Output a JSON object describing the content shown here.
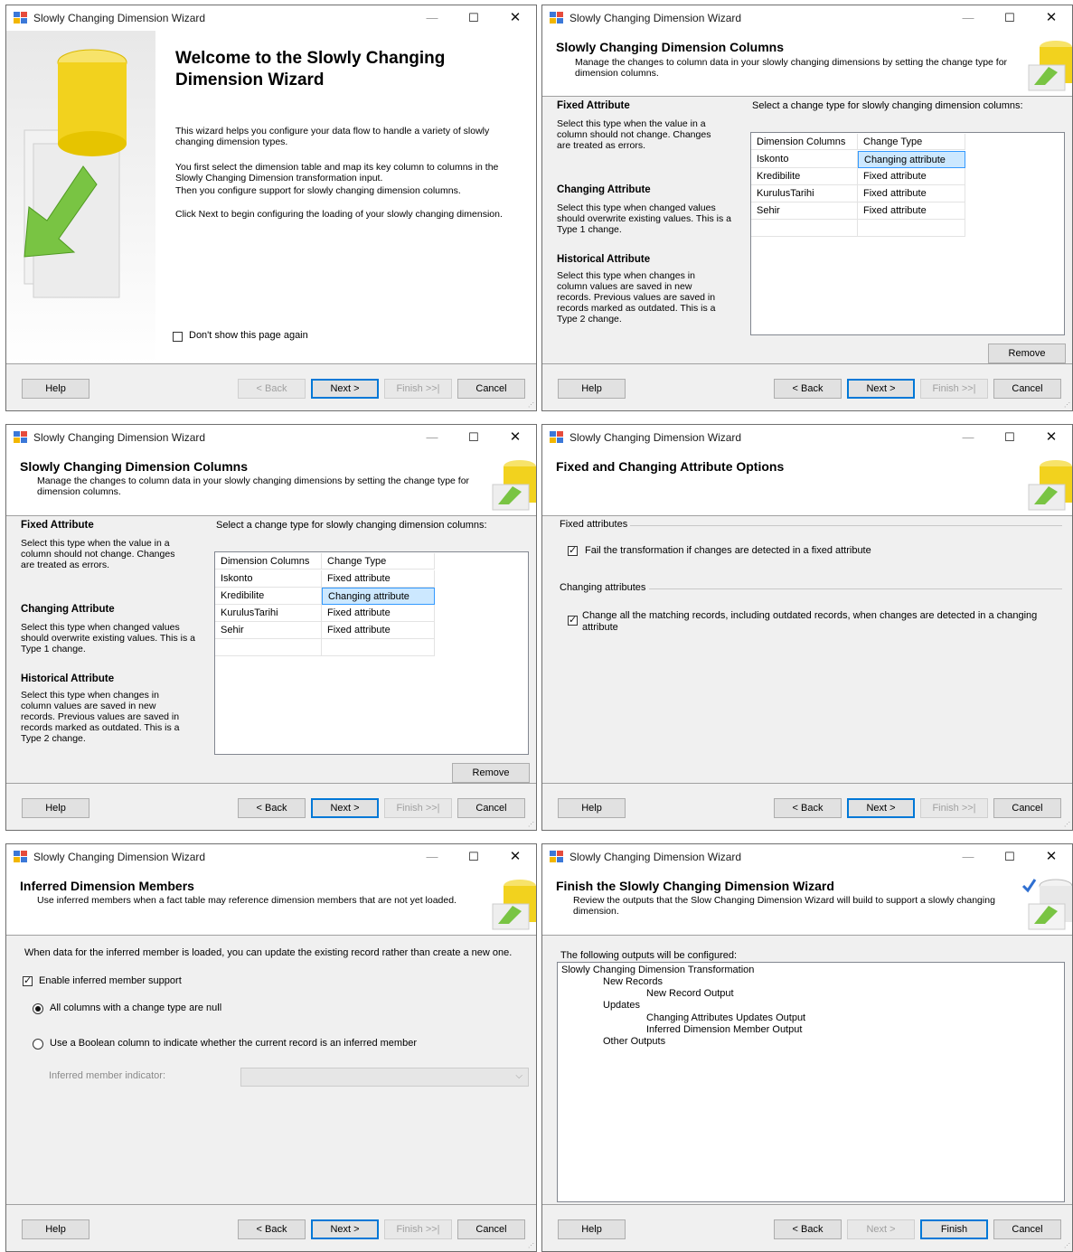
{
  "window": {
    "title": "Slowly Changing Dimension Wizard",
    "minimize": "—",
    "maximize": "☐",
    "close": "✕"
  },
  "buttons": {
    "help": "Help",
    "back": "< Back",
    "next": "Next >",
    "finish": "Finish >>|",
    "finish_final": "Finish",
    "cancel": "Cancel",
    "remove": "Remove"
  },
  "welcome": {
    "title": "Welcome to the Slowly Changing Dimension Wizard",
    "p1": "This wizard helps you configure your data flow to handle a variety of slowly changing dimension types.",
    "p2": "You first select the dimension table and map its key column to columns in the Slowly Changing Dimension transformation input.",
    "p3": "Then you configure support for slowly changing dimension columns.",
    "p4": "Click Next to begin configuring the loading of your slowly changing dimension.",
    "dont_show": "Don't show this page again"
  },
  "columns_page": {
    "title": "Slowly Changing Dimension Columns",
    "subtitle": "Manage the changes to column data in your slowly changing dimensions by setting the change type for dimension columns.",
    "fixed_title": "Fixed Attribute",
    "fixed_desc": "Select this type when the value in a column should not change. Changes are treated as errors.",
    "changing_title": "Changing Attribute",
    "changing_desc": "Select this type when changed values should overwrite existing values. This is a Type 1 change.",
    "historical_title": "Historical Attribute",
    "historical_desc": "Select this type when changes in column values are saved in new records. Previous values are saved in records marked as outdated. This is a Type 2 change.",
    "select_label": "Select a change type for slowly changing dimension columns:",
    "col_header_1": "Dimension Columns",
    "col_header_2": "Change Type"
  },
  "grid_a": {
    "rows": [
      {
        "col": "Iskonto",
        "type": "Changing attribute"
      },
      {
        "col": "Kredibilite",
        "type": "Fixed attribute"
      },
      {
        "col": "KurulusTarihi",
        "type": "Fixed attribute"
      },
      {
        "col": "Sehir",
        "type": "Fixed attribute"
      }
    ]
  },
  "grid_b": {
    "rows": [
      {
        "col": "Iskonto",
        "type": "Fixed attribute"
      },
      {
        "col": "Kredibilite",
        "type": "Changing attribute"
      },
      {
        "col": "KurulusTarihi",
        "type": "Fixed attribute"
      },
      {
        "col": "Sehir",
        "type": "Fixed attribute"
      }
    ]
  },
  "options_page": {
    "title": "Fixed and Changing Attribute Options",
    "fixed_group": "Fixed attributes",
    "fixed_check": "Fail the transformation if changes are detected in a fixed attribute",
    "changing_group": "Changing attributes",
    "changing_check_l1": "Change all the matching records, including outdated records, when changes are detected in a changing",
    "changing_check_l2": "attribute"
  },
  "inferred_page": {
    "title": "Inferred Dimension Members",
    "subtitle": "Use inferred members when a fact table may reference dimension members that are not yet loaded.",
    "intro": "When data for the inferred member is loaded, you can update the existing record rather than create a new one.",
    "enable": "Enable inferred member support",
    "radio_all": "All columns with a change type are null",
    "radio_bool": "Use a Boolean column to indicate whether the current record is an inferred member",
    "indicator_label": "Inferred member indicator:",
    "indicator_value": ""
  },
  "finish_page": {
    "title": "Finish the Slowly Changing Dimension Wizard",
    "subtitle": "Review the outputs that the Slow Changing Dimension Wizard will build to support a slowly changing dimension.",
    "outputs_label": "The following outputs will be configured:",
    "outputs": {
      "root": "Slowly Changing Dimension Transformation",
      "new_records": "New Records",
      "new_record_output": "New Record Output",
      "updates": "Updates",
      "changing_updates": "Changing Attributes Updates Output",
      "inferred_output": "Inferred Dimension Member Output",
      "other_outputs": "Other Outputs"
    }
  },
  "colors": {
    "selection": "#cce8ff",
    "selection_border": "#3399ff",
    "primary_button": "#0078d7",
    "window_bg": "#f0f0f0"
  }
}
